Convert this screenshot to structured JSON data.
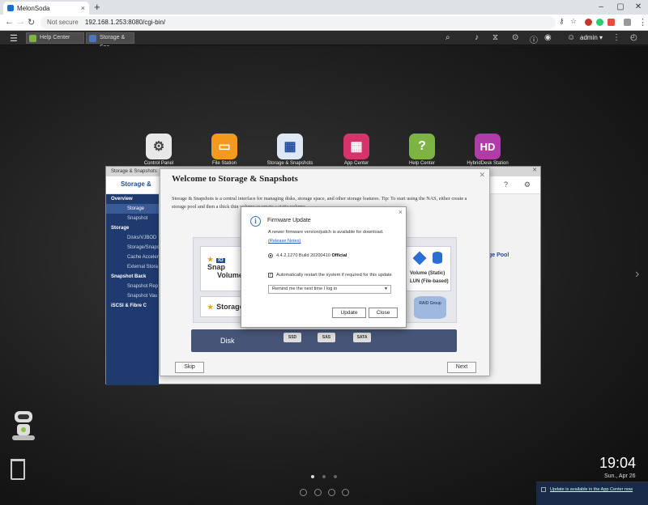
{
  "browser": {
    "tab_title": "MelonSoda",
    "new_tab": "+",
    "not_secure": "Not secure",
    "url": "192.168.1.253:8080/cgi-bin/"
  },
  "qts": {
    "tabs": [
      {
        "label": "Help Center"
      },
      {
        "label": "Storage & Sna..."
      }
    ],
    "user": "admin ▾"
  },
  "desktop": {
    "apps": [
      {
        "label": "Control Panel",
        "glyph": "⚙",
        "color": "#e8e8e8"
      },
      {
        "label": "File Station",
        "glyph": "▭",
        "color": "#f39a1e"
      },
      {
        "label": "Storage & Snapshots",
        "glyph": "▦",
        "color": "#dfe7f4"
      },
      {
        "label": "App Center",
        "glyph": "▦",
        "color": "#d6336c"
      },
      {
        "label": "Help Center",
        "glyph": "?",
        "color": "#7cb342"
      },
      {
        "label": "HybridDesk Station",
        "glyph": "HD",
        "color": "#b03ca8"
      }
    ],
    "clock": "19:04",
    "date": "Sun., Apr 26",
    "notification": "Update is available in the App Center now"
  },
  "storage_window": {
    "title": "Storage & Snapshots",
    "header_title": "Storage &",
    "sidebar": [
      {
        "label": "Overview",
        "type": "grp"
      },
      {
        "label": "Storage",
        "type": "sel"
      },
      {
        "label": "Snapshot",
        "type": "sub"
      },
      {
        "label": "Storage",
        "type": "grp"
      },
      {
        "label": "Disks/VJBOD",
        "type": "sub"
      },
      {
        "label": "Storage/Snaps",
        "type": "sub"
      },
      {
        "label": "Cache Acceler",
        "type": "sub"
      },
      {
        "label": "External Stora",
        "type": "sub"
      },
      {
        "label": "Snapshot Back",
        "type": "grp"
      },
      {
        "label": "Snapshot Rep",
        "type": "sub"
      },
      {
        "label": "Snapshot Vau",
        "type": "sub"
      },
      {
        "label": "iSCSI & Fibre C",
        "type": "grp"
      }
    ],
    "right_panel_title": "ge Pool"
  },
  "welcome": {
    "title": "Welcome to Storage & Snapshots",
    "description": "Storage & Snapshots is a central interface for managing disks, storage space, and other storage features. Tip: To start using the NAS, either create a storage pool and then a thick thin volume or create a static volume.",
    "snap_label": "Snap",
    "volume_label": "Volume",
    "storage_label": "Storage",
    "io_label": "IO",
    "volume_static": "Volume (Static)",
    "lun": "LUN (File-based)",
    "raid_group": "RAID Group",
    "disk_label": "Disk",
    "chips": [
      "SSD",
      "SAS",
      "SATA"
    ],
    "skip": "Skip",
    "next": "Next"
  },
  "firmware": {
    "title": "Firmware Update",
    "message": "A newer firmware version/patch is available for download.",
    "release_notes": "(Release Notes)",
    "version": "4.4.2.1270 Build 20200410",
    "version_tag": "Official",
    "auto_restart": "Automatically restart the system if required for this update",
    "remind_select": "Remind me the next time I log in",
    "update_button": "Update",
    "close_button": "Close"
  }
}
